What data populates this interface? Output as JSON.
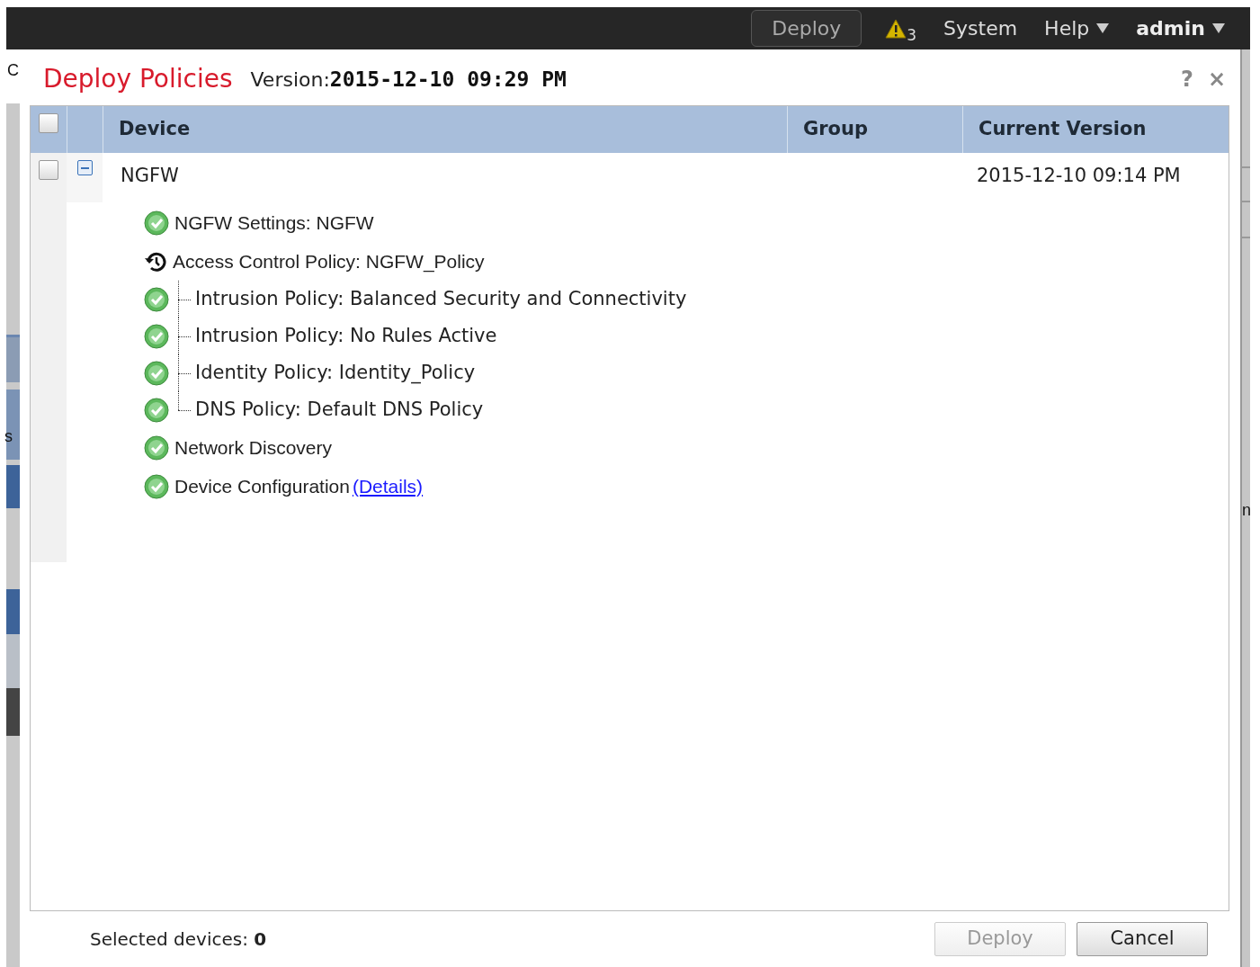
{
  "top_bar": {
    "deploy_button": "Deploy",
    "alert_count": "3",
    "menu": [
      {
        "label": "System",
        "caret": false
      },
      {
        "label": "Help",
        "caret": true
      },
      {
        "label": "admin",
        "caret": true
      }
    ]
  },
  "background_fragments": [
    "C",
    "s",
    "n"
  ],
  "dialog": {
    "title": "Deploy Policies",
    "version_label": "Version:",
    "version": "2015-12-10 09:29 PM",
    "help": "?",
    "close": "×"
  },
  "table": {
    "select_all_checked": false,
    "columns": [
      "Device",
      "Group",
      "Current Version"
    ],
    "rows": [
      {
        "device": "NGFW",
        "current_version": "2015-12-10 09:14 PM",
        "checked": false,
        "expanded": true,
        "items": [
          {
            "text": "NGFW Settings: NGFW",
            "kind": "ok"
          },
          {
            "text": "Access Control Policy: NGFW_Policy",
            "kind": "pending",
            "children": [
              {
                "text": "Intrusion Policy: Balanced Security and Connectivity",
                "kind": "ok"
              },
              {
                "text": "Intrusion Policy: No Rules Active",
                "kind": "ok"
              },
              {
                "text": "Identity Policy: Identity_Policy",
                "kind": "ok"
              },
              {
                "text": "DNS Policy: Default DNS Policy",
                "kind": "ok"
              }
            ]
          },
          {
            "text": "Network Discovery",
            "kind": "ok"
          },
          {
            "text": "Device Configuration",
            "kind": "ok",
            "link": "(Details)"
          }
        ]
      }
    ]
  },
  "footer": {
    "selected_label": "Selected devices:",
    "selected_count": "0",
    "buttons": [
      {
        "label": "Deploy",
        "disabled": true
      },
      {
        "label": "Cancel",
        "disabled": false
      }
    ]
  }
}
